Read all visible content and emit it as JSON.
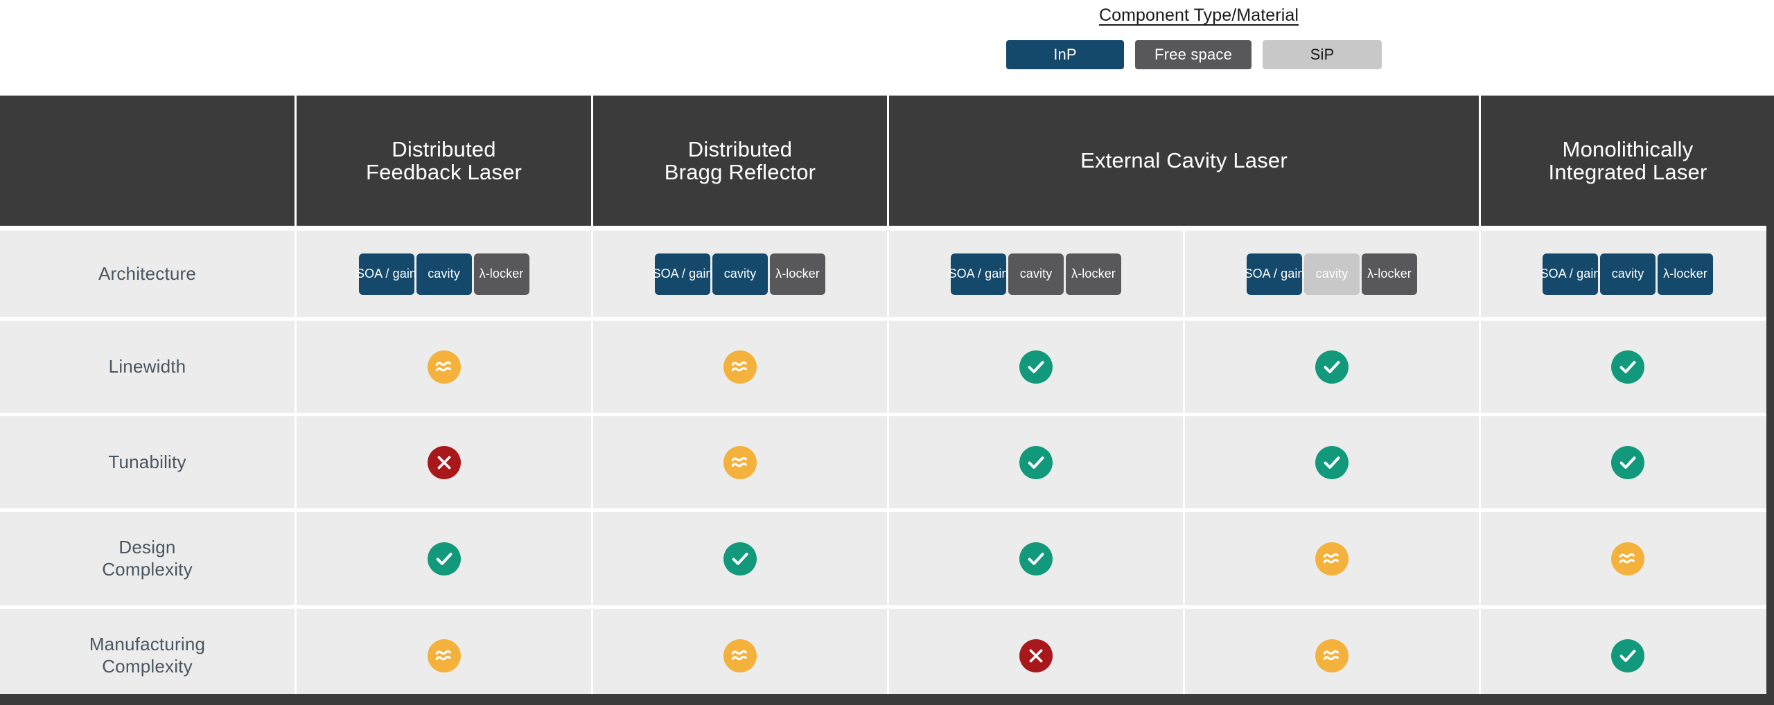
{
  "legend": {
    "title": "Component Type/Material",
    "items": [
      {
        "label": "InP",
        "key": "inp",
        "color": "#15496B"
      },
      {
        "label": "Free space",
        "key": "free",
        "color": "#58585A"
      },
      {
        "label": "SiP",
        "key": "sip",
        "color": "#C8C8C8"
      }
    ]
  },
  "table": {
    "corner_label": "",
    "columns": [
      {
        "line1": "Distributed",
        "line2": "Feedback Laser"
      },
      {
        "line1": "Distributed",
        "line2": "Bragg Reflector"
      },
      {
        "line1": "External Cavity Laser",
        "line2": ""
      },
      {
        "line1": "Monolithically",
        "line2": "Integrated Laser"
      }
    ],
    "rows": [
      {
        "label_line1": "Architecture",
        "label_line2": ""
      },
      {
        "label_line1": "Linewidth",
        "label_line2": ""
      },
      {
        "label_line1": "Tunability",
        "label_line2": ""
      },
      {
        "label_line1": "Design",
        "label_line2": "Complexity"
      },
      {
        "label_line1": "Manufacturing",
        "label_line2": "Complexity"
      }
    ],
    "chip_labels": {
      "soa": "SOA / gain",
      "cavity": "cavity",
      "locker": "λ-locker"
    },
    "architecture": [
      {
        "soa": "inp",
        "cavity": "inp",
        "locker": "free"
      },
      {
        "soa": "inp",
        "cavity": "inp",
        "locker": "free"
      },
      {
        "soa": "inp",
        "cavity": "free",
        "locker": "free"
      },
      {
        "soa": "inp",
        "cavity": "sip",
        "locker": "free"
      },
      {
        "soa": "inp",
        "cavity": "inp",
        "locker": "inp"
      }
    ],
    "ratings": {
      "linewidth": [
        "mid",
        "mid",
        "good",
        "good",
        "good"
      ],
      "tunability": [
        "bad",
        "mid",
        "good",
        "good",
        "good"
      ],
      "design_complexity": [
        "good",
        "good",
        "good",
        "mid",
        "mid"
      ],
      "manufacturing_complexity": [
        "mid",
        "mid",
        "bad",
        "mid",
        "good"
      ]
    },
    "rating_symbols": {
      "good": "check",
      "mid": "approximately-equal",
      "bad": "cross"
    },
    "rating_colors": {
      "good": "#12997B",
      "mid": "#F4B13C",
      "bad": "#A8181B"
    }
  }
}
